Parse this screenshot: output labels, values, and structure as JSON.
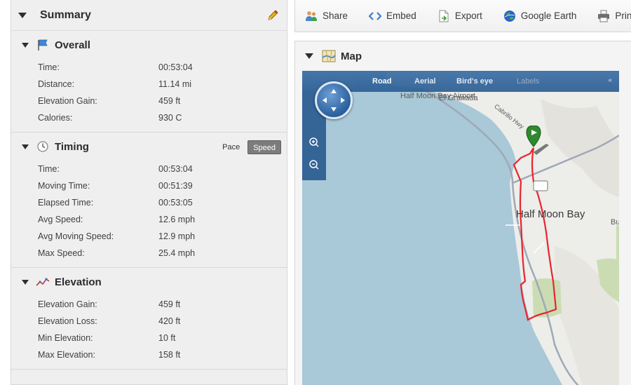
{
  "summary": {
    "title": "Summary",
    "overall": {
      "title": "Overall",
      "rows": [
        {
          "label": "Time:",
          "value": "00:53:04"
        },
        {
          "label": "Distance:",
          "value": "11.14 mi"
        },
        {
          "label": "Elevation Gain:",
          "value": "459 ft"
        },
        {
          "label": "Calories:",
          "value": "930 C"
        }
      ]
    },
    "timing": {
      "title": "Timing",
      "toggle": {
        "pace": "Pace",
        "speed": "Speed",
        "selected": "Speed"
      },
      "rows": [
        {
          "label": "Time:",
          "value": "00:53:04"
        },
        {
          "label": "Moving Time:",
          "value": "00:51:39"
        },
        {
          "label": "Elapsed Time:",
          "value": "00:53:05"
        },
        {
          "label": "Avg Speed:",
          "value": "12.6 mph"
        },
        {
          "label": "Avg Moving Speed:",
          "value": "12.9 mph"
        },
        {
          "label": "Max Speed:",
          "value": "25.4 mph"
        }
      ]
    },
    "elevation": {
      "title": "Elevation",
      "rows": [
        {
          "label": "Elevation Gain:",
          "value": "459 ft"
        },
        {
          "label": "Elevation Loss:",
          "value": "420 ft"
        },
        {
          "label": "Min Elevation:",
          "value": "10 ft"
        },
        {
          "label": "Max Elevation:",
          "value": "158 ft"
        }
      ]
    }
  },
  "toolbar": {
    "share": "Share",
    "embed": "Embed",
    "export": "Export",
    "google_earth": "Google Earth",
    "print": "Print"
  },
  "map": {
    "title": "Map",
    "tabs": {
      "road": "Road",
      "aerial": "Aerial",
      "birds_eye": "Bird's eye",
      "labels": "Labels",
      "selected": "Road"
    },
    "places": {
      "bay_airport": "Half Moon Bay Airport",
      "el_granada": "El Granada",
      "half_moon_bay": "Half Moon Bay",
      "burl": "Burl",
      "cabrillo_hwy": "Cabrillo Hwy"
    }
  },
  "colors": {
    "route": "#e8242c",
    "water": "#a9c8d8",
    "land": "#ededea",
    "map_bar": "#2c5d92",
    "pin": "#2f8a2f"
  }
}
